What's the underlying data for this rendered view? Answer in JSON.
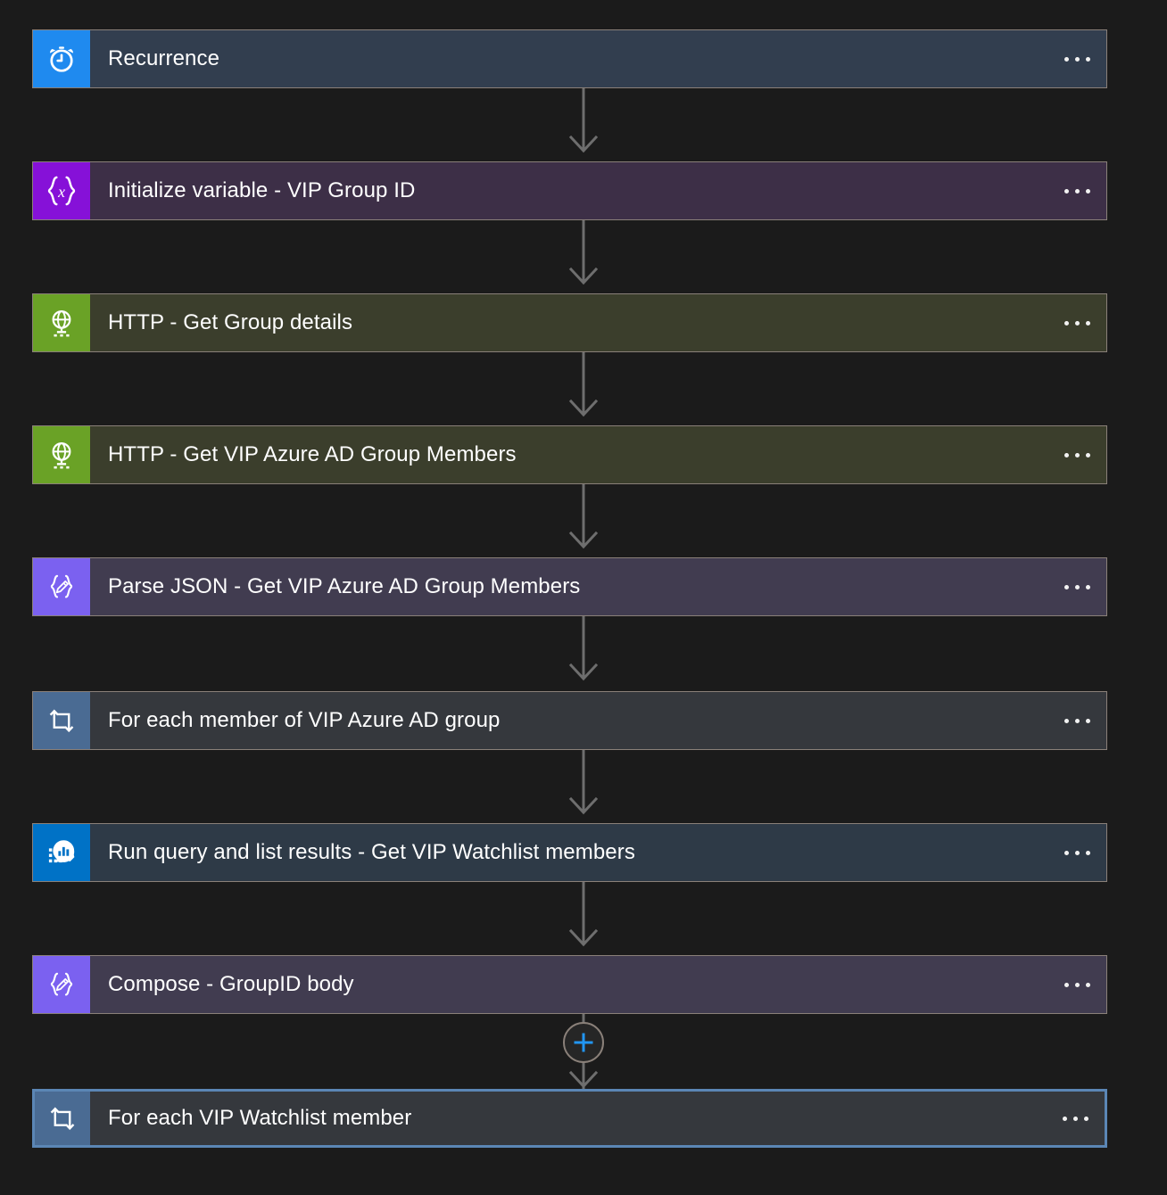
{
  "theme": {
    "canvas_bg": "#1b1b1b",
    "card_border": "#8a8079",
    "selected_border": "#5b86b5",
    "connector": "#6e6e6e",
    "accent_plus": "#1f8aef",
    "title_color": "#ffffff"
  },
  "flow": {
    "nodes": [
      {
        "id": "recurrence",
        "title": "Recurrence",
        "icon": "alarm-clock-icon",
        "icon_class": "ic-recurrence",
        "body_class": "bg-recurrence",
        "icon_bg": "#1f8aef",
        "body_bg": "#323e4f",
        "selected": false,
        "menu_label": "..."
      },
      {
        "id": "initialize-variable-vip-group-id",
        "title": "Initialize variable - VIP Group ID",
        "icon": "variable-braces-icon",
        "icon_class": "ic-variable",
        "body_class": "bg-variable",
        "icon_bg": "#8611d8",
        "body_bg": "#3d2f47",
        "selected": false,
        "menu_label": "..."
      },
      {
        "id": "http-get-group-details",
        "title": "HTTP - Get Group details",
        "icon": "globe-network-icon",
        "icon_class": "ic-http",
        "body_class": "bg-http",
        "icon_bg": "#6aa226",
        "body_bg": "#3b3e2c",
        "selected": false,
        "menu_label": "..."
      },
      {
        "id": "http-get-vip-azure-ad-group-members",
        "title": "HTTP - Get VIP Azure AD Group Members",
        "icon": "globe-network-icon",
        "icon_class": "ic-http",
        "body_class": "bg-http",
        "icon_bg": "#6aa226",
        "body_bg": "#3b3e2c",
        "selected": false,
        "menu_label": "..."
      },
      {
        "id": "parse-json-get-vip-azure-ad-group-members",
        "title": "Parse JSON - Get VIP Azure AD Group Members",
        "icon": "braces-pencil-icon",
        "icon_class": "ic-parsejson",
        "body_class": "bg-parsejson",
        "icon_bg": "#7b61f0",
        "body_bg": "#413c50",
        "selected": false,
        "menu_label": "..."
      },
      {
        "id": "for-each-member-of-vip-azure-ad-group",
        "title": "For each member of VIP Azure AD group",
        "icon": "loop-repeat-icon",
        "icon_class": "ic-foreach",
        "body_class": "bg-foreach",
        "icon_bg": "#4a6b93",
        "body_bg": "#35383d",
        "selected": false,
        "menu_label": "..."
      },
      {
        "id": "run-query-and-list-results-get-vip-watchlist-members",
        "title": "Run query and list results - Get VIP Watchlist members",
        "icon": "log-analytics-icon",
        "icon_class": "ic-loganalytic",
        "body_class": "bg-loganalytic",
        "icon_bg": "#0072c6",
        "body_bg": "#2e3a47",
        "selected": false,
        "menu_label": "..."
      },
      {
        "id": "compose-groupid-body",
        "title": "Compose - GroupID body",
        "icon": "braces-pencil-icon",
        "icon_class": "ic-parsejson",
        "body_class": "bg-parsejson",
        "icon_bg": "#7b61f0",
        "body_bg": "#413c50",
        "selected": false,
        "menu_label": "..."
      },
      {
        "id": "for-each-vip-watchlist-member",
        "title": "For each VIP Watchlist member",
        "icon": "loop-repeat-icon",
        "icon_class": "ic-foreach",
        "body_class": "bg-foreach",
        "icon_bg": "#4a6b93",
        "body_bg": "#35383d",
        "selected": true,
        "menu_label": "..."
      }
    ],
    "insert_button": {
      "label": "+",
      "name": "insert-step-button",
      "after_node": "compose-groupid-body"
    }
  }
}
